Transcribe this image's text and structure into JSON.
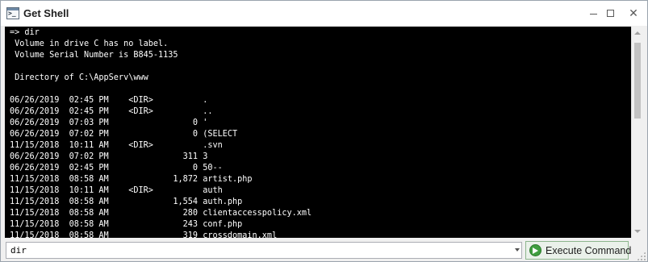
{
  "window": {
    "title": "Get Shell",
    "app_icon_glyph": ">_",
    "icons": {
      "app": "terminal-icon",
      "minimize": "minimize-icon",
      "maximize": "maximize-icon",
      "close": "close-icon"
    },
    "close_glyph": "✕"
  },
  "console": {
    "lines": [
      "=> dir",
      " Volume in drive C has no label.",
      " Volume Serial Number is B845-1135",
      "",
      " Directory of C:\\AppServ\\www",
      "",
      "06/26/2019  02:45 PM    <DIR>          .",
      "06/26/2019  02:45 PM    <DIR>          ..",
      "06/26/2019  07:03 PM                 0 '",
      "06/26/2019  07:02 PM                 0 (SELECT",
      "11/15/2018  10:11 AM    <DIR>          .svn",
      "06/26/2019  07:02 PM               311 3",
      "06/26/2019  02:45 PM                 0 50--",
      "11/15/2018  08:58 AM             1,872 artist.php",
      "11/15/2018  10:11 AM    <DIR>          auth",
      "11/15/2018  08:58 AM             1,554 auth.php",
      "11/15/2018  08:58 AM               280 clientaccesspolicy.xml",
      "11/15/2018  08:58 AM               243 conf.php",
      "11/15/2018  08:58 AM               319 crossdomain.xml"
    ],
    "colors": {
      "background": "#000000",
      "text": "#ffffff"
    }
  },
  "command": {
    "value": "dir",
    "placeholder": ""
  },
  "execute_button": {
    "label": "Execute Command",
    "icon": "play-circle-icon",
    "color": "#3f9e3f"
  }
}
